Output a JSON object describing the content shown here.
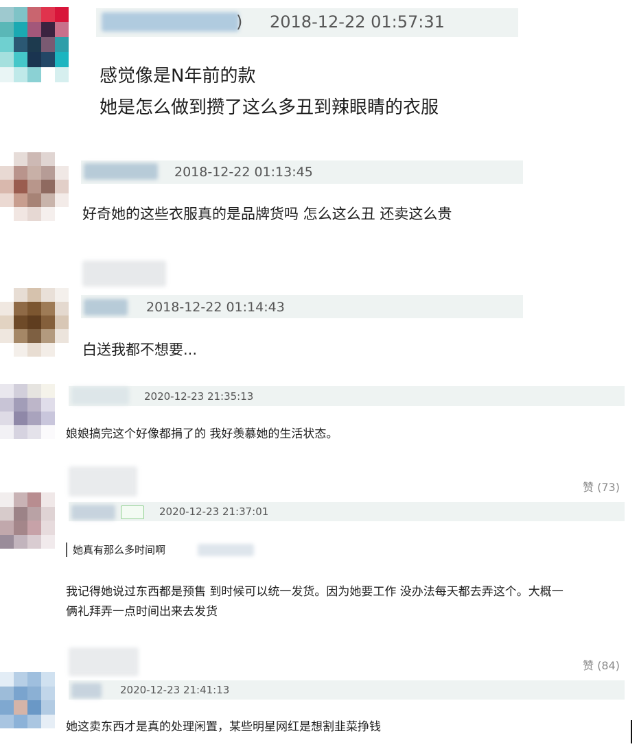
{
  "comments": [
    {
      "timestamp": "2018-12-22 01:57:31",
      "username_suffix": ")",
      "lines": [
        "感觉像是N年前的款",
        "她是怎么做到攒了这么多丑到辣眼睛的衣服"
      ]
    },
    {
      "timestamp": "2018-12-22 01:13:45",
      "lines": [
        "好奇她的这些衣服真的是品牌货吗 怎么这么丑 还卖这么贵"
      ]
    },
    {
      "timestamp": "2018-12-22 01:14:43",
      "lines": [
        "白送我都不想要..."
      ]
    },
    {
      "timestamp": "2020-12-23 21:35:13",
      "lines": [
        "娘娘搞完这个好像都捐了的 我好羡慕她的生活状态。"
      ]
    },
    {
      "timestamp": "2020-12-23 21:37:01",
      "quote": "她真有那么多时间啊",
      "lines": [
        "我记得她说过东西都是预售 到时候可以统一发货。因为她要工作 没办法每天都去弄这个。大概一",
        "俩礼拜弄一点时间出来去发货"
      ]
    },
    {
      "timestamp": "2020-12-23 21:41:13",
      "lines": [
        "她这卖东西才是真的处理闲置，某些明星网红是想割韭菜挣钱"
      ]
    }
  ],
  "likes": [
    "赞 (73)",
    "赞 (84)"
  ],
  "colors": {
    "meta_bar": "#eef3f2",
    "timestamp": "#555555",
    "like": "#8a8a8a"
  },
  "icons": [
    "avatar",
    "text-cursor-icon"
  ]
}
